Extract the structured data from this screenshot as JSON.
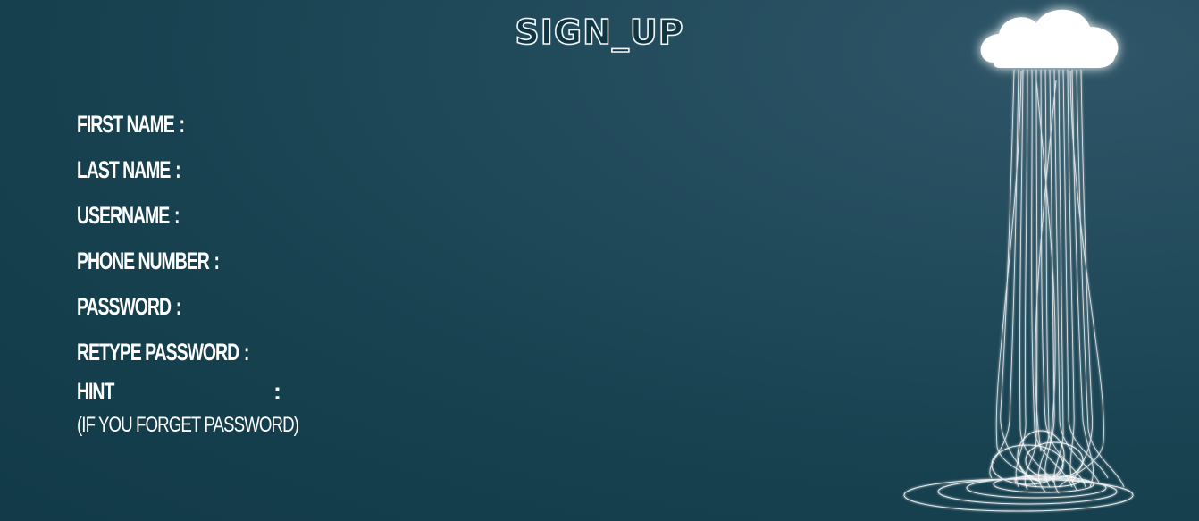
{
  "page": {
    "title": "SIGN_UP"
  },
  "form": {
    "fields": [
      {
        "label": "FIRST NAME",
        "colon": ":"
      },
      {
        "label": "LAST NAME",
        "colon": ":"
      },
      {
        "label": "USERNAME",
        "colon": ":"
      },
      {
        "label": "PHONE NUMBER",
        "colon": ":"
      },
      {
        "label": "PASSWORD",
        "colon": ":"
      },
      {
        "label": "RETYPE PASSWORD",
        "colon": ":"
      }
    ],
    "hint": {
      "label": "HINT",
      "colon": ":",
      "subtext": "(IF YOU FORGET PASSWORD)"
    }
  },
  "illustration": {
    "icon": "cloud-rain-icon",
    "color": "#ffffff"
  },
  "colors": {
    "background": "#1b4453",
    "text": "#ffffff"
  }
}
